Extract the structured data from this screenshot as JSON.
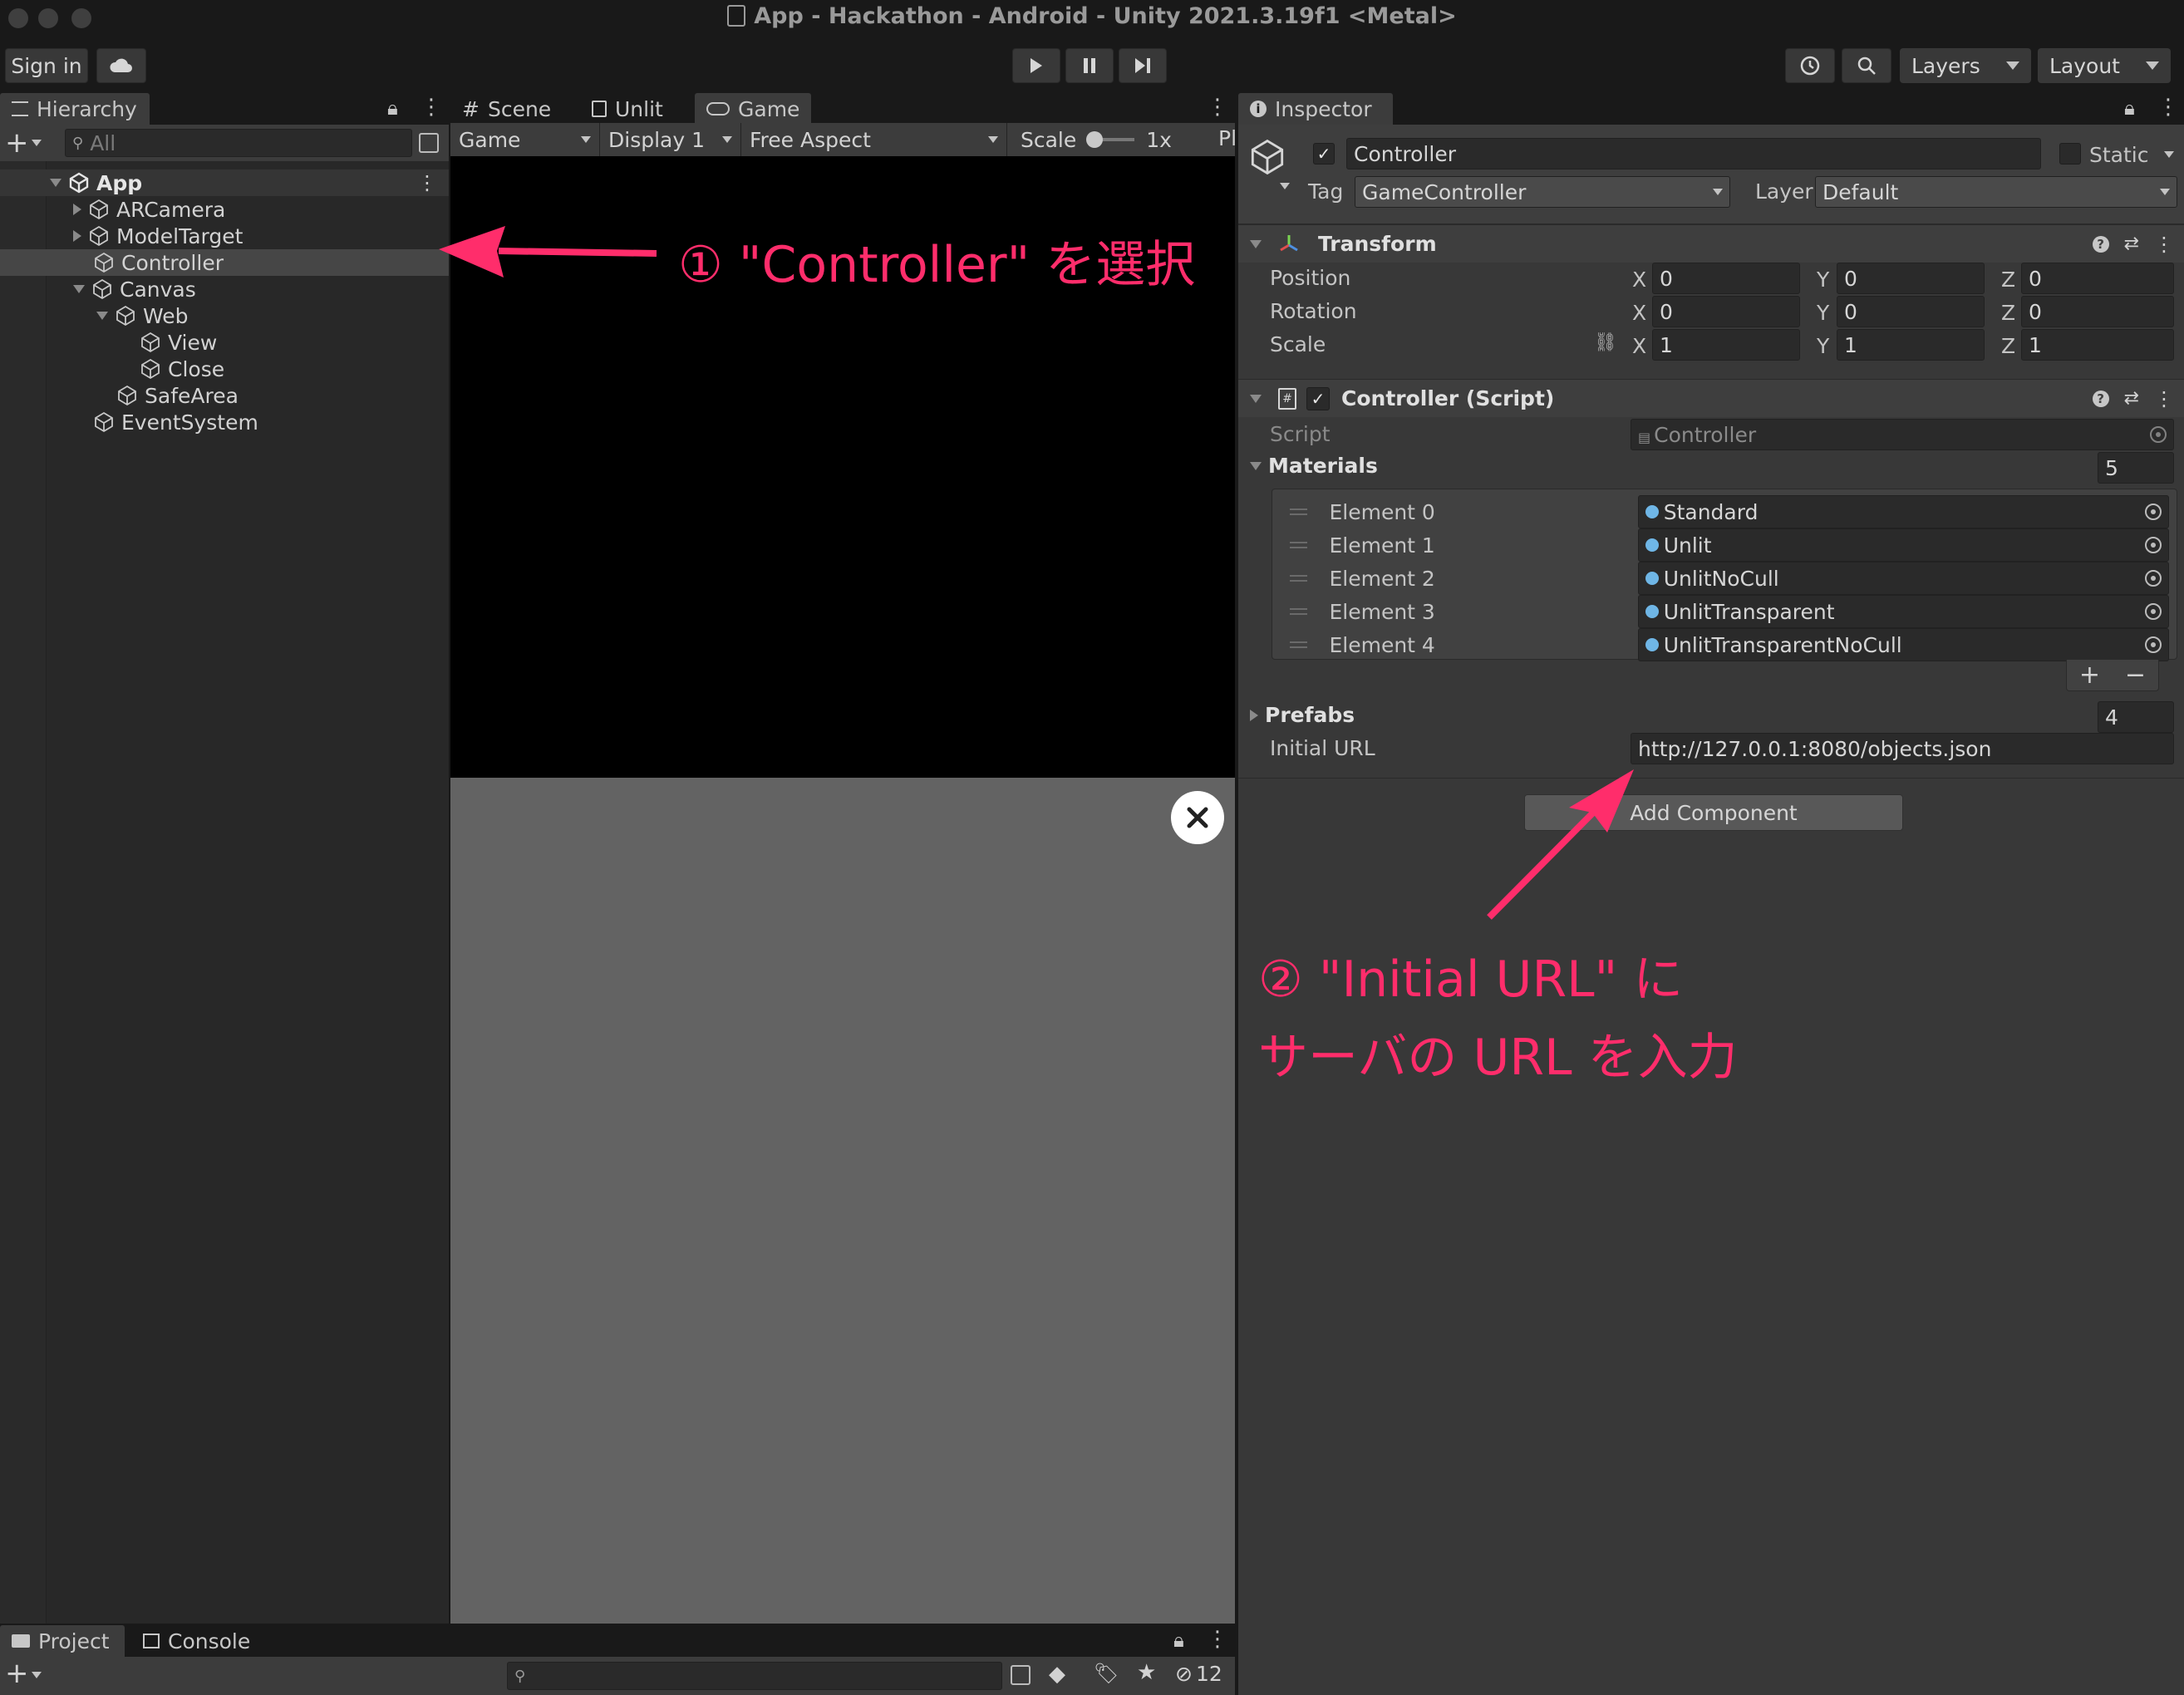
{
  "window": {
    "title": "App - Hackathon - Android - Unity 2021.3.19f1 <Metal>"
  },
  "toolbar": {
    "sign_in": "Sign in",
    "layers": "Layers",
    "layout": "Layout"
  },
  "hierarchy": {
    "tab": "Hierarchy",
    "search_placeholder": "All",
    "items": [
      {
        "label": "App"
      },
      {
        "label": "ARCamera"
      },
      {
        "label": "ModelTarget"
      },
      {
        "label": "Controller"
      },
      {
        "label": "Canvas"
      },
      {
        "label": "Web"
      },
      {
        "label": "View"
      },
      {
        "label": "Close"
      },
      {
        "label": "SafeArea"
      },
      {
        "label": "EventSystem"
      }
    ]
  },
  "game_view": {
    "tabs": [
      "Scene",
      "Unlit",
      "Game"
    ],
    "game_dropdown": "Game",
    "display": "Display 1",
    "aspect": "Free Aspect",
    "scale_label": "Scale",
    "scale_value": "1x",
    "play_trunc": "Pl"
  },
  "inspector": {
    "tab": "Inspector",
    "object_name": "Controller",
    "static_label": "Static",
    "tag_label": "Tag",
    "tag_value": "GameController",
    "layer_label": "Layer",
    "layer_value": "Default",
    "transform": {
      "title": "Transform",
      "position_label": "Position",
      "rotation_label": "Rotation",
      "scale_label": "Scale",
      "axis_x": "X",
      "axis_y": "Y",
      "axis_z": "Z",
      "position": [
        "0",
        "0",
        "0"
      ],
      "rotation": [
        "0",
        "0",
        "0"
      ],
      "scale": [
        "1",
        "1",
        "1"
      ]
    },
    "script_component": {
      "title": "Controller (Script)",
      "script_label": "Script",
      "script_value": "Controller",
      "materials_label": "Materials",
      "materials_count": "5",
      "elements": [
        {
          "label": "Element 0",
          "value": "Standard"
        },
        {
          "label": "Element 1",
          "value": "Unlit"
        },
        {
          "label": "Element 2",
          "value": "UnlitNoCull"
        },
        {
          "label": "Element 3",
          "value": "UnlitTransparent"
        },
        {
          "label": "Element 4",
          "value": "UnlitTransparentNoCull"
        }
      ],
      "prefabs_label": "Prefabs",
      "prefabs_count": "4",
      "initial_url_label": "Initial URL",
      "initial_url_value": "http://127.0.0.1:8080/objects.json"
    },
    "add_component": "Add Component"
  },
  "bottom": {
    "project_tab": "Project",
    "console_tab": "Console",
    "hidden_count": "12"
  },
  "annotations": {
    "step1": "① \"Controller\" を選択",
    "step2_line1": "② \"Initial URL\" に",
    "step2_line2": "サーバの URL を入力",
    "color": "#ff2d6b"
  }
}
